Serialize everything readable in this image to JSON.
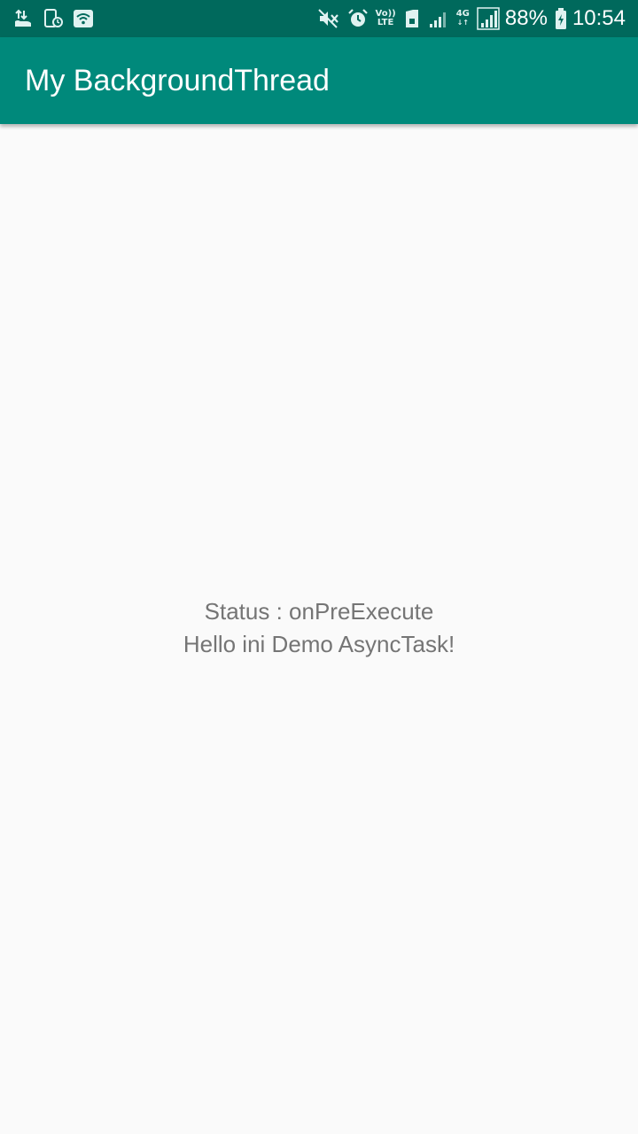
{
  "status_bar": {
    "left_icons": [
      "data-transfer-icon",
      "screen-timer-icon",
      "wifi-icon"
    ],
    "right_icons": [
      "mute-icon",
      "alarm-icon",
      "volte-icon",
      "sim-icon",
      "signal-icon",
      "4g-icon",
      "signal-icon-2",
      "battery-icon"
    ],
    "volte_top": "Vo))",
    "volte_bottom": "LTE",
    "net_label": "4G",
    "battery_text": "88%",
    "time": "10:54"
  },
  "app_bar": {
    "title": "My BackgroundThread",
    "color": "#00897b",
    "status_color": "#00695c"
  },
  "main": {
    "status_text": "Status : onPreExecute",
    "hello_text": "Hello ini Demo AsyncTask!"
  }
}
